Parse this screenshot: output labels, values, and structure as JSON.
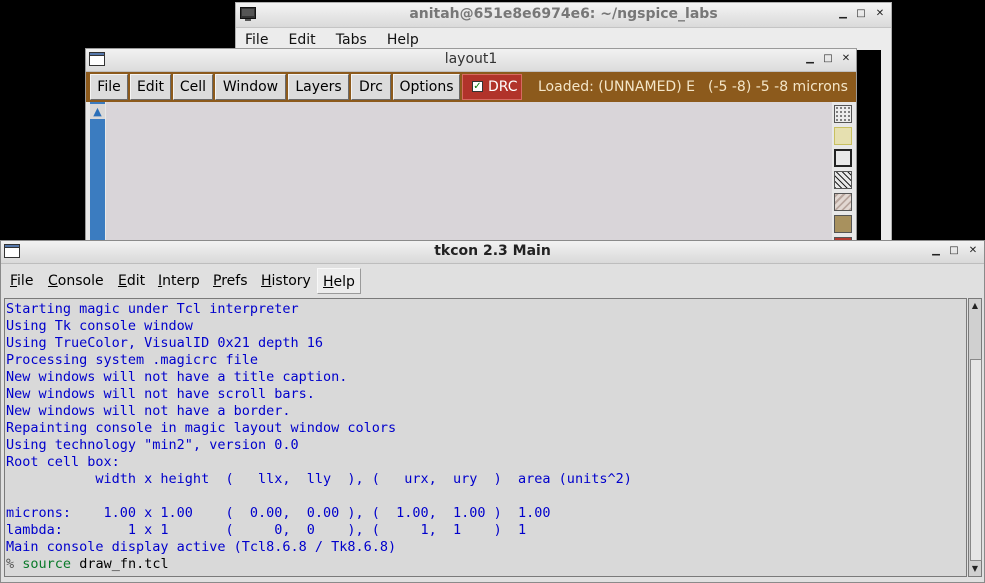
{
  "terminal": {
    "title": "anitah@651e8e6974e6: ~/ngspice_labs",
    "menu": [
      "File",
      "Edit",
      "Tabs",
      "Help"
    ],
    "controls": {
      "minimize": "▁",
      "maximize": "□",
      "close": "✕"
    }
  },
  "layout": {
    "title": "layout1",
    "toolbar": [
      "File",
      "Edit",
      "Cell",
      "Window",
      "Layers",
      "Drc",
      "Options"
    ],
    "drc_label": "DRC",
    "drc_checked": true,
    "status": "Loaded: (UNNAMED) E",
    "coords": "(-5 -8) -5 -8 microns",
    "controls": {
      "minimize": "▁",
      "maximize": "□",
      "close": "✕"
    },
    "colors": {
      "toolbar_bg": "#8c5a1c",
      "drc_bg": "#b1332a",
      "canvas_bg": "#d9d5d9"
    }
  },
  "tkcon": {
    "title": "tkcon 2.3 Main",
    "menu": [
      {
        "accel": "F",
        "rest": "ile"
      },
      {
        "accel": "C",
        "rest": "onsole"
      },
      {
        "accel": "E",
        "rest": "dit"
      },
      {
        "accel": "I",
        "rest": "nterp"
      },
      {
        "accel": "P",
        "rest": "refs"
      },
      {
        "accel": "H",
        "rest": "istory"
      },
      {
        "accel": "H",
        "rest": "elp"
      }
    ],
    "controls": {
      "minimize": "▁",
      "maximize": "□",
      "close": "✕"
    },
    "output": [
      "Starting magic under Tcl interpreter",
      "Using Tk console window",
      "Using TrueColor, VisualID 0x21 depth 16",
      "Processing system .magicrc file",
      "New windows will not have a title caption.",
      "New windows will not have scroll bars.",
      "New windows will not have a border.",
      "Repainting console in magic layout window colors",
      "Using technology \"min2\", version 0.0",
      "Root cell box:",
      "           width x height  (   llx,  lly  ), (   urx,  ury  )  area (units^2)",
      "",
      "microns:    1.00 x 1.00    (  0.00,  0.00 ), (  1.00,  1.00 )  1.00",
      "lambda:        1 x 1       (     0,  0    ), (     1,  1    )  1",
      "Main console display active (Tcl8.6.8 / Tk8.6.8)"
    ],
    "prompt": "%",
    "command_keyword": "source",
    "command_arg": " draw_fn.tcl",
    "colors": {
      "output_text": "#0000cc",
      "console_bg": "#d9d9d9",
      "command_keyword": "#0a7a2a"
    }
  }
}
